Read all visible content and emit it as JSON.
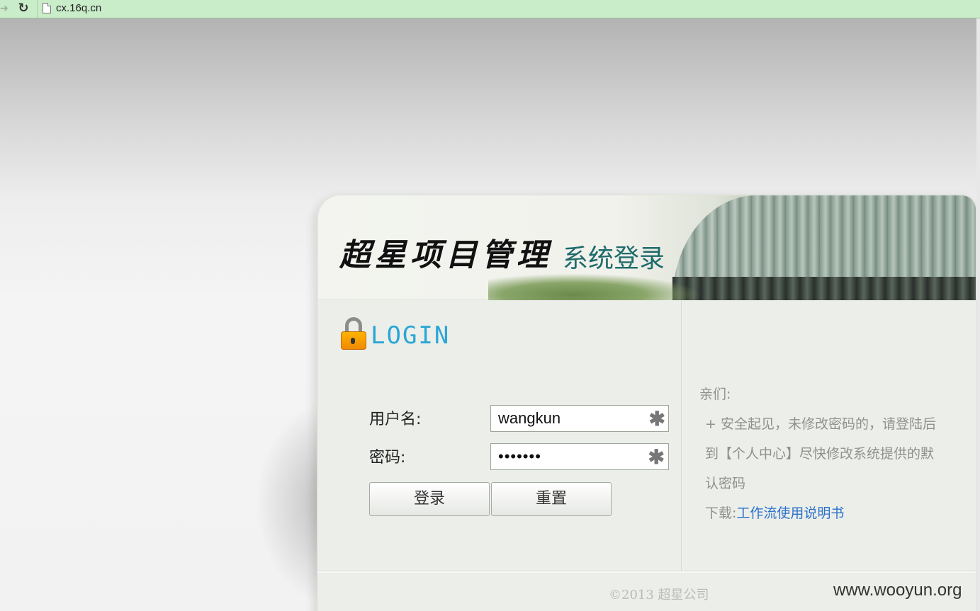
{
  "browser": {
    "url": "cx.16q.cn",
    "forward_icon": "forward-arrow-icon",
    "reload_icon": "reload-icon",
    "page_icon": "page-icon"
  },
  "banner": {
    "title": "超星项目管理",
    "subtitle": "系统登录"
  },
  "login": {
    "heading": "LOGIN",
    "lock_icon": "lock-icon",
    "username_label": "用户名:",
    "username_value": "wangkun",
    "password_label": "密码:",
    "password_value": "•••••••",
    "required_icon": "asterisk-icon",
    "login_button": "登录",
    "reset_button": "重置"
  },
  "notice": {
    "greeting": "亲们:",
    "line1": "+ 安全起见，未修改密码的，请登陆后",
    "line2": "到【个人中心】尽快修改系统提供的默",
    "line3": "认密码",
    "download_label": "下载:",
    "download_link": "工作流使用说明书"
  },
  "footer": {
    "copyright": "©2013    超星公司"
  },
  "watermark": "www.wooyun.org",
  "colors": {
    "addr_bar": "#c9ecc9",
    "login_heading": "#2aa7d6",
    "subtitle": "#1f6b6b",
    "link": "#2a72c8"
  }
}
